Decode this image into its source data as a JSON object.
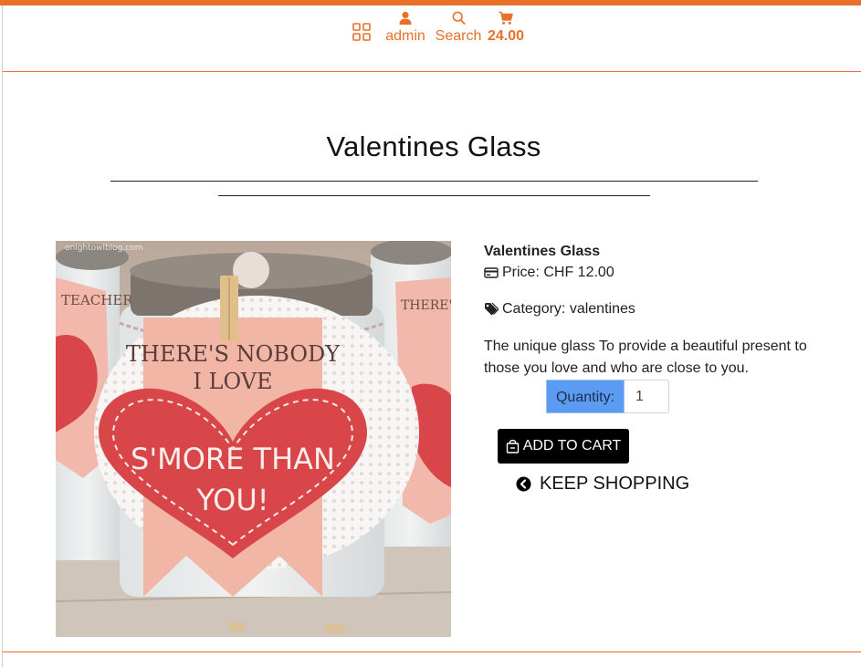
{
  "nav": {
    "admin_label": "admin",
    "search_label": "Search",
    "cart_total": "24.00",
    "accent_color": "#e8702a"
  },
  "page": {
    "title": "Valentines Glass"
  },
  "product": {
    "name": "Valentines Glass",
    "price_label": "Price: CHF 12.00",
    "category_label": "Category: valentines",
    "description": "The unique glass To provide a beautiful present to those you love and who are close to you.",
    "image": {
      "tag_line1": "THERE'S NOBODY",
      "tag_line2": "I LOVE",
      "heart_line1": "S'MORE THAN",
      "heart_line2": "YOU!",
      "side_tag_left": "TEACHER ANT",
      "side_tag_right": "THERE'S ASS",
      "watermark": "onightowlblog.com"
    }
  },
  "quantity": {
    "label": "Quantity:",
    "value": "1"
  },
  "actions": {
    "add_to_cart": "ADD TO CART",
    "keep_shopping": "KEEP SHOPPING"
  }
}
